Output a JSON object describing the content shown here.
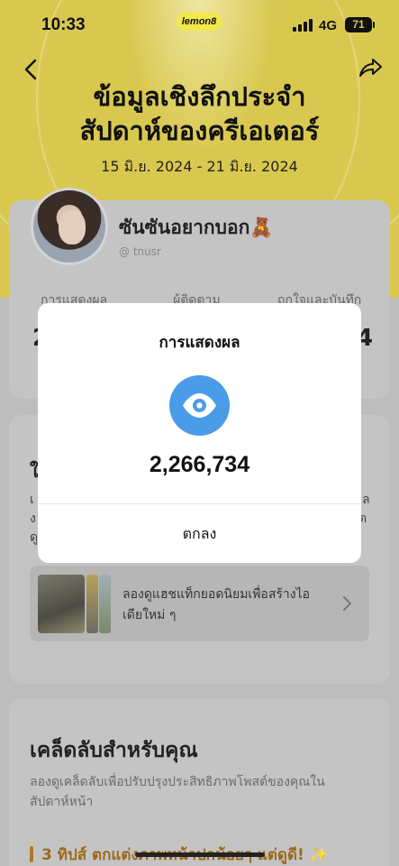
{
  "status_bar": {
    "time": "10:33",
    "network": "4G",
    "battery": "71"
  },
  "brand": "lemon8",
  "header": {
    "title_line1": "ข้อมูลเชิงลึกประจำ",
    "title_line2": "สัปดาห์ของครีเอเตอร์",
    "date_range": "15 มิ.ย. 2024 - 21 มิ.ย. 2024"
  },
  "profile": {
    "name": "ซันซันอยากบอก🧸",
    "handle": "@ tnusr",
    "stats": [
      {
        "label": "การแสดงผล"
      },
      {
        "label": "ผู้ติดตาม"
      },
      {
        "label": "ถูกใจและบันทึก"
      }
    ],
    "stat_value_left_cut": "2",
    "stat_value_right_cut": "4"
  },
  "section2": {
    "title_cut": "ใ",
    "line1_left": "เ",
    "line1_right": "ล",
    "line2_left": "ง",
    "line2_right": "ต",
    "line3_left": "ดู",
    "hashtag_card_text": "ลองดูแฮชแท็กยอดนิยมเพื่อสร้างไอเดียใหม่ ๆ"
  },
  "tips": {
    "title": "เคล็ดลับสำหรับคุณ",
    "subtitle": "ลองดูเคล็ดลับเพื่อปรับปรุงประสิทธิภาพโพสต์ของคุณในสัปดาห์หน้า",
    "item1": "3 ทิปส์ ตกแต่งภาพหน้าปกน้อยๆ แต่ดูดี! ✨"
  },
  "modal": {
    "title": "การแสดงผล",
    "icon": "eye-icon",
    "value": "2,266,734",
    "ok_label": "ตกลง"
  },
  "colors": {
    "accent_yellow": "#f3e84a",
    "eye_blue": "#4b9ce8"
  }
}
